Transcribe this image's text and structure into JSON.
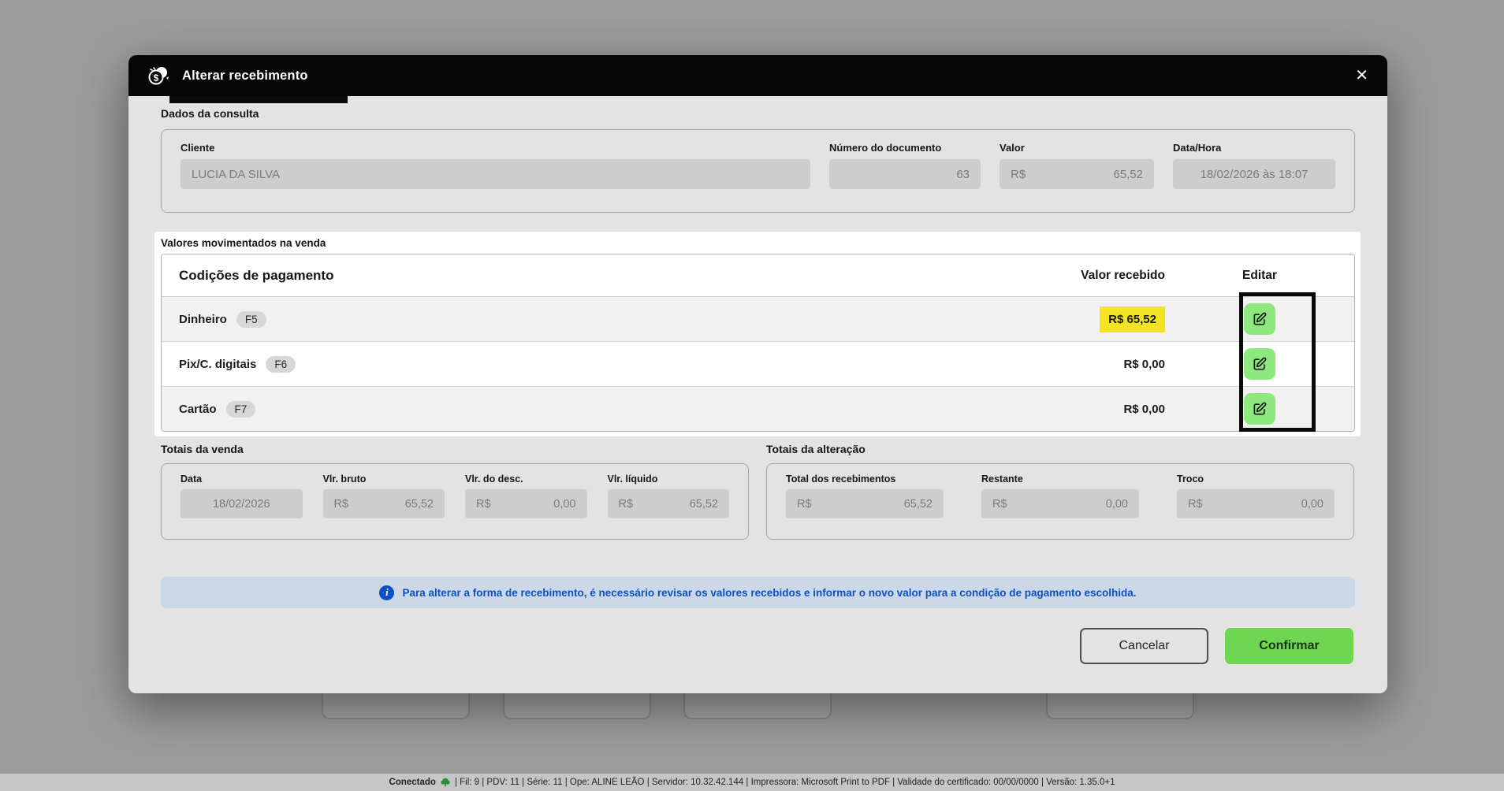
{
  "modal": {
    "title": "Alterar recebimento",
    "close_label": "✕",
    "consulta": {
      "section_title": "Dados da consulta",
      "cliente": {
        "label": "Cliente",
        "value": "LUCIA DA SILVA"
      },
      "documento": {
        "label": "Número do documento",
        "value": "63"
      },
      "valor": {
        "label": "Valor",
        "prefix": "R$",
        "value": "65,52"
      },
      "datahora": {
        "label": "Data/Hora",
        "value": "18/02/2026 às 18:07"
      }
    },
    "valores": {
      "section_title": "Valores movimentados na venda",
      "table": {
        "col_payment": "Codições de pagamento",
        "col_value": "Valor recebido",
        "col_edit": "Editar",
        "rows": [
          {
            "name": "Dinheiro",
            "key": "F5",
            "value": "R$ 65,52"
          },
          {
            "name": "Pix/C. digitais",
            "key": "F6",
            "value": "R$ 0,00"
          },
          {
            "name": "Cartão",
            "key": "F7",
            "value": "R$ 0,00"
          }
        ]
      }
    },
    "totais_venda": {
      "section_title": "Totais da venda",
      "data": {
        "label": "Data",
        "value": "18/02/2026"
      },
      "bruto": {
        "label": "Vlr. bruto",
        "prefix": "R$",
        "value": "65,52"
      },
      "desc": {
        "label": "Vlr. do desc.",
        "prefix": "R$",
        "value": "0,00"
      },
      "liquido": {
        "label": "Vlr. líquido",
        "prefix": "R$",
        "value": "65,52"
      }
    },
    "totais_alteracao": {
      "section_title": "Totais da alteração",
      "recebimentos": {
        "label": "Total dos recebimentos",
        "prefix": "R$",
        "value": "65,52"
      },
      "restante": {
        "label": "Restante",
        "prefix": "R$",
        "value": "0,00"
      },
      "troco": {
        "label": "Troco",
        "prefix": "R$",
        "value": "0,00"
      }
    },
    "info_banner": "Para alterar a forma de recebimento, é necessário revisar os valores recebidos e informar o novo valor para a condição de pagamento escolhida.",
    "buttons": {
      "cancel": "Cancelar",
      "confirm": "Confirmar"
    }
  },
  "footer": {
    "status": "Conectado",
    "details": "| Fil: 9 | PDV: 11 | Série: 11 | Ope: ALINE LEÃO | Servidor: 10.32.42.144 | Impressora: Microsoft Print to PDF | Validade do certificado: 00/00/0000 | Versão: 1.35.0+1"
  },
  "colors": {
    "highlight_yellow": "#f4e41f",
    "edit_green": "#8de87e",
    "confirm_green": "#6fd653",
    "banner_blue_bg": "#ccd8e8",
    "banner_blue_text": "#0a52c4",
    "header_black": "#060606",
    "overlay_gray": "#9c9c9c"
  }
}
